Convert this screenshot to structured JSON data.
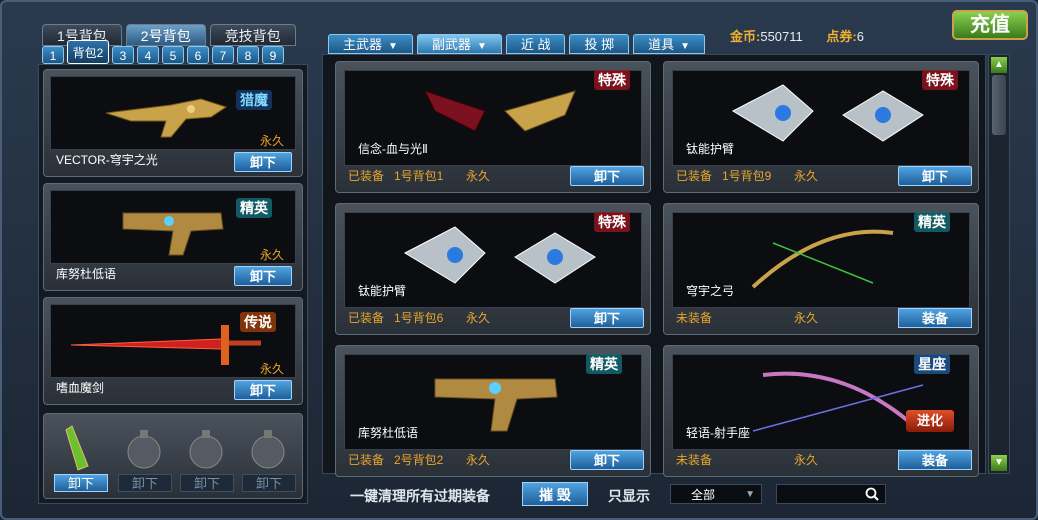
{
  "top": {
    "bag_tabs": [
      "1号背包",
      "2号背包",
      "竞技背包"
    ],
    "active_bag_tab": "2号背包",
    "sub_tabs": [
      "1",
      "背包2",
      "3",
      "4",
      "5",
      "6",
      "7",
      "8",
      "9"
    ],
    "gold_label": "金币:",
    "gold_value": "550711",
    "points_label": "点券:",
    "points_value": "6",
    "recharge_label": "充值"
  },
  "categories": [
    {
      "label": "主武器",
      "has_dropdown": true
    },
    {
      "label": "副武器",
      "has_dropdown": true,
      "active": true
    },
    {
      "label": "近  战",
      "has_dropdown": false
    },
    {
      "label": "投  掷",
      "has_dropdown": false
    },
    {
      "label": "道具",
      "has_dropdown": true
    }
  ],
  "left_items": [
    {
      "name": "VECTOR-穹宇之光",
      "duration": "永久",
      "badge": "猎魔",
      "button": "卸下"
    },
    {
      "name": "库努杜低语",
      "duration": "永久",
      "badge": "精英",
      "button": "卸下"
    },
    {
      "name": "嗜血魔剑",
      "duration": "永久",
      "badge": "传说",
      "button": "卸下"
    }
  ],
  "grenade_buttons": [
    "卸下",
    "卸下",
    "卸下",
    "卸下"
  ],
  "cards": [
    {
      "name": "信念-血与光Ⅱ",
      "status": "已装备",
      "bag": "1号背包1",
      "duration": "永久",
      "badge": "特殊",
      "button": "卸下"
    },
    {
      "name": "钛能护臂",
      "status": "已装备",
      "bag": "1号背包9",
      "duration": "永久",
      "badge": "特殊",
      "button": "卸下"
    },
    {
      "name": "钛能护臂",
      "status": "已装备",
      "bag": "1号背包6",
      "duration": "永久",
      "badge": "特殊",
      "button": "卸下"
    },
    {
      "name": "穹宇之弓",
      "status": "未装备",
      "bag": "",
      "duration": "永久",
      "badge": "精英",
      "button": "装备"
    },
    {
      "name": "库努杜低语",
      "status": "已装备",
      "bag": "2号背包2",
      "duration": "永久",
      "badge": "精英",
      "button": "卸下"
    },
    {
      "name": "轻语-射手座",
      "status": "未装备",
      "bag": "",
      "duration": "永久",
      "badge": "星座",
      "button": "装备",
      "evolve": "进化"
    }
  ],
  "bottom": {
    "clear_text": "一键清理所有过期装备",
    "destroy_label": "摧  毁",
    "show_only_label": "只显示",
    "filter_value": "全部",
    "search_value": ""
  },
  "colors": {
    "accent": "#4fa3e0",
    "gold_text": "#e9a62a",
    "recharge": "#6ab83a"
  }
}
